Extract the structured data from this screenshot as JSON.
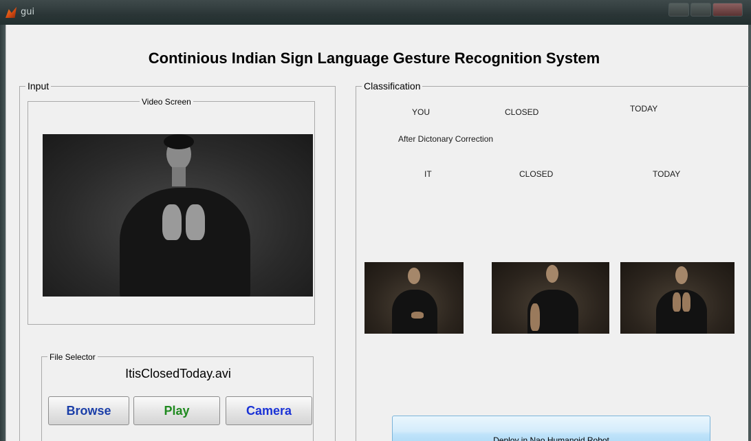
{
  "window": {
    "title": "gui"
  },
  "app": {
    "title": "Continious Indian Sign Language Gesture Recognition System"
  },
  "input": {
    "label": "Input",
    "video_screen": {
      "label": "Video Screen"
    },
    "file_selector": {
      "label": "File Selector",
      "file_name": "ItisClosedToday.avi",
      "browse_label": "Browse",
      "play_label": "Play",
      "camera_label": "Camera"
    }
  },
  "classification": {
    "label": "Classification",
    "recognized_words": [
      "YOU",
      "CLOSED",
      "TODAY"
    ],
    "correction_label": "After Dictonary Correction",
    "corrected_words": [
      "IT",
      "CLOSED",
      "TODAY"
    ],
    "deploy_label": "Deploy in Nao Humanoid Robot"
  },
  "colors": {
    "browse_text": "#1a3ea8",
    "play_text": "#1f8a1f",
    "camera_text": "#1a32d6",
    "deploy_button": "#bfe3fa"
  }
}
